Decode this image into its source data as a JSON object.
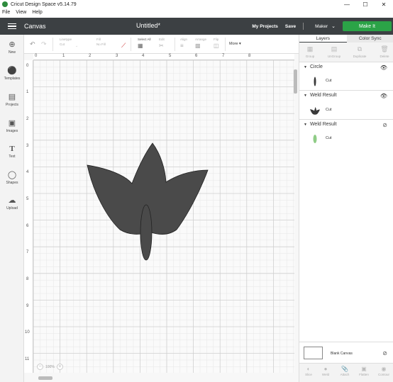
{
  "window": {
    "title": "Cricut Design Space  v5.14.79",
    "minimize": "—",
    "maximize": "☐",
    "close": "✕"
  },
  "menu": [
    "File",
    "View",
    "Help"
  ],
  "header": {
    "section": "Canvas",
    "doc_title": "Untitled*",
    "my_projects": "My Projects",
    "save": "Save",
    "separator": "|",
    "machine": "Maker",
    "make_it": "Make It"
  },
  "left_tools": [
    {
      "label": "New",
      "icon": "plus-icon"
    },
    {
      "label": "Templates",
      "icon": "shirt-icon"
    },
    {
      "label": "Projects",
      "icon": "projects-icon"
    },
    {
      "label": "Images",
      "icon": "image-icon"
    },
    {
      "label": "Text",
      "icon": "text-icon"
    },
    {
      "label": "Shapes",
      "icon": "shapes-icon"
    },
    {
      "label": "Upload",
      "icon": "upload-icon"
    }
  ],
  "edit_toolbar": {
    "linetype_label": "Linetype",
    "linetype_value": "Cut",
    "fill_label": "Fill",
    "fill_value": "No Fill",
    "select_all": "Select All",
    "edit": "Edit",
    "align": "Align",
    "arrange": "Arrange",
    "flip": "Flip",
    "more": "More ▾"
  },
  "rulers": {
    "top": [
      "0",
      "1",
      "2",
      "3",
      "4",
      "5",
      "6",
      "7",
      "8"
    ],
    "left": [
      "0",
      "1",
      "2",
      "3",
      "4",
      "5",
      "6",
      "7",
      "8",
      "9",
      "10",
      "11"
    ]
  },
  "zoom": {
    "minus": "−",
    "value": "100%",
    "plus": "+"
  },
  "panel": {
    "tabs": [
      "Layers",
      "Color Sync"
    ],
    "tools": [
      "Group",
      "UnGroup",
      "Duplicate",
      "Delete"
    ],
    "layers": [
      {
        "name": "Circle",
        "operation": "Cut",
        "visible": true,
        "color": "#3a3a3a"
      },
      {
        "name": "Weld Result",
        "operation": "Cut",
        "visible": true,
        "color": "#3a3a3a"
      },
      {
        "name": "Weld Result",
        "operation": "Cut",
        "visible": false,
        "color": "#8fcc86"
      }
    ],
    "blank_canvas": "Blank Canvas",
    "bottom_tools": [
      "Slice",
      "Weld",
      "Attach",
      "Flatten",
      "Contour"
    ]
  },
  "colors": {
    "header_bg": "#3c4043",
    "make_it": "#2ba347",
    "shape_fill": "#4a4a4a",
    "grid_major": "#cfcfcf",
    "grid_minor": "#e6e6e6"
  }
}
